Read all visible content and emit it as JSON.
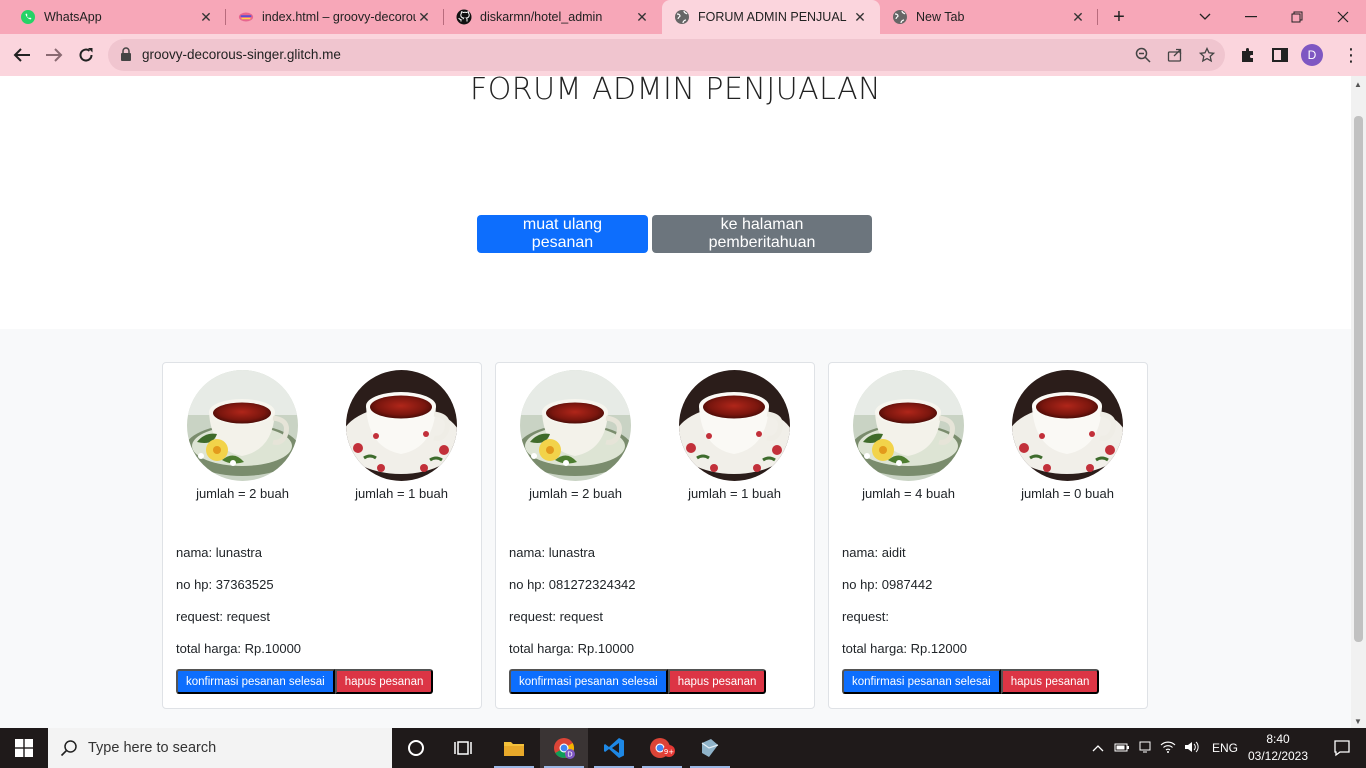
{
  "browser": {
    "tabs": [
      {
        "title": "WhatsApp",
        "icon": "whatsapp-icon"
      },
      {
        "title": "index.html – groovy-decorous",
        "icon": "glitch-icon"
      },
      {
        "title": "diskarmn/hotel_admin",
        "icon": "github-icon"
      },
      {
        "title": "FORUM ADMIN PENJUAL",
        "icon": "globe-icon"
      },
      {
        "title": "New Tab",
        "icon": "globe-icon"
      }
    ],
    "url": "groovy-decorous-singer.glitch.me",
    "profile_initial": "D"
  },
  "page": {
    "title": "FORUM ADMIN PENJUALAN",
    "reload_button": "muat ulang pesanan",
    "notification_button": "ke halaman pemberitahuan"
  },
  "orders": [
    {
      "items": [
        "jumlah = 2 buah",
        "jumlah = 1 buah"
      ],
      "nama": "nama: lunastra",
      "hp": "no hp: 37363525",
      "request": "request: request",
      "total": "total harga: Rp.10000",
      "confirm": "konfirmasi pesanan selesai",
      "delete": "hapus pesanan"
    },
    {
      "items": [
        "jumlah = 2 buah",
        "jumlah = 1 buah"
      ],
      "nama": "nama: lunastra",
      "hp": "no hp: 081272324342",
      "request": "request: request",
      "total": "total harga: Rp.10000",
      "confirm": "konfirmasi pesanan selesai",
      "delete": "hapus pesanan"
    },
    {
      "items": [
        "jumlah = 4 buah",
        "jumlah = 0 buah"
      ],
      "nama": "nama: aidit",
      "hp": "no hp: 0987442",
      "request": "request:",
      "total": "total harga: Rp.12000",
      "confirm": "konfirmasi pesanan selesai",
      "delete": "hapus pesanan"
    }
  ],
  "taskbar": {
    "search_placeholder": "Type here to search",
    "language": "ENG",
    "time": "8:40",
    "date": "03/12/2023"
  },
  "colors": {
    "primary": "#0d6efd",
    "secondary": "#6c757d",
    "danger": "#dc3545",
    "tabbar": "#f7a7b8"
  }
}
